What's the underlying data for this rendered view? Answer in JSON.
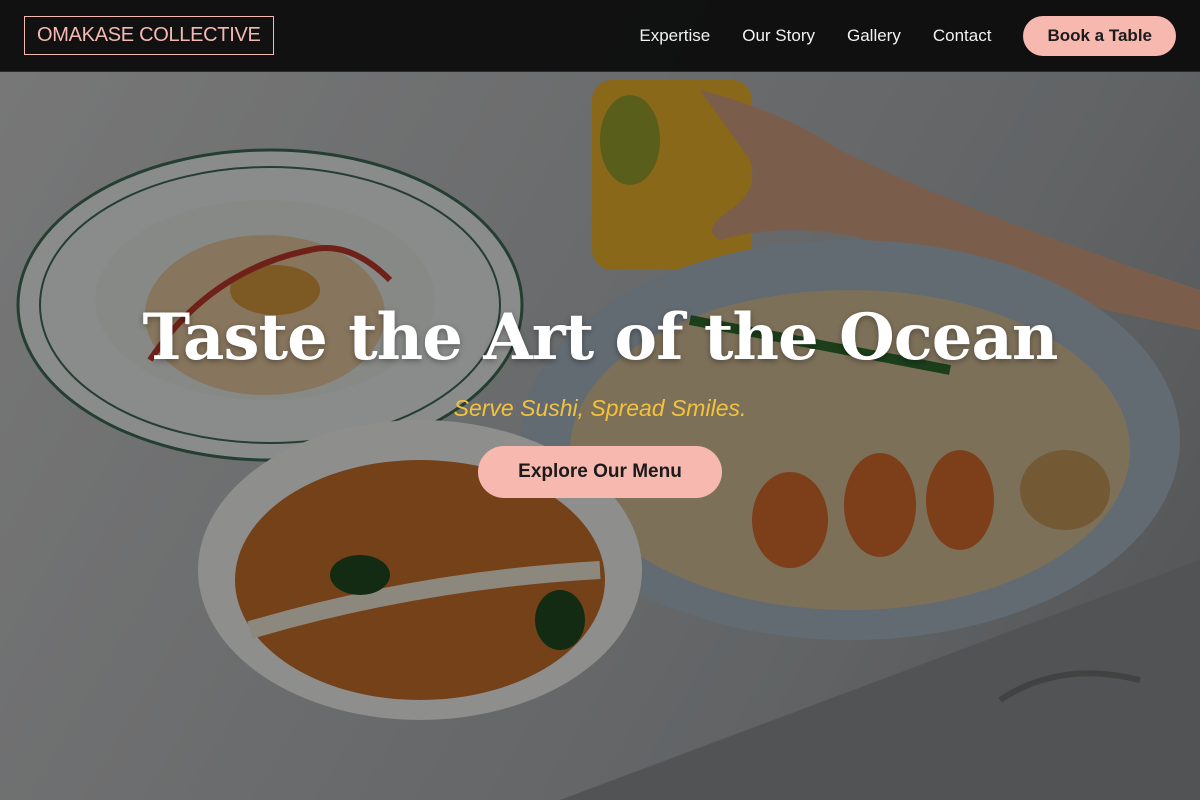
{
  "brand": {
    "logo_text": "OMAKASE COLLECTIVE"
  },
  "nav": {
    "links": [
      {
        "label": "Expertise"
      },
      {
        "label": "Our Story"
      },
      {
        "label": "Gallery"
      },
      {
        "label": "Contact"
      }
    ],
    "cta_label": "Book a Table"
  },
  "hero": {
    "title": "Taste the Art of the Ocean",
    "subtitle": "Serve Sushi, Spread Smiles.",
    "button_label": "Explore Our Menu",
    "background": "photo of seafood dishes: pasta plate, curry soup bowl, shrimp pad thai, hand holding orange drink"
  },
  "colors": {
    "accent_pink": "#f7b8b0",
    "accent_gold": "#f4c23a",
    "nav_bg": "#0a0a0a",
    "title_white": "#ffffff"
  }
}
